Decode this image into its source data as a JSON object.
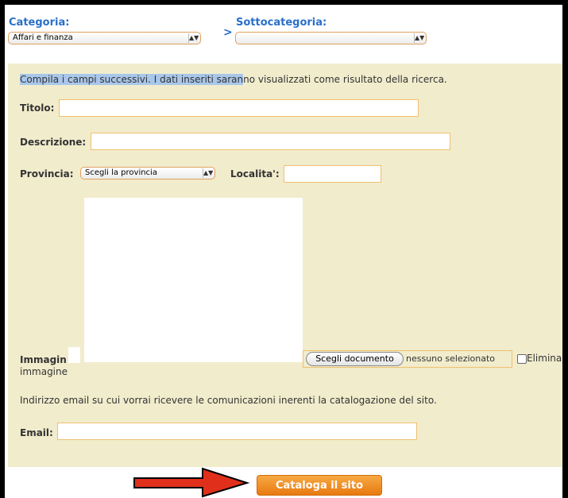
{
  "header": {
    "categoria_label": "Categoria:",
    "categoria_value": "Affari e finanza",
    "separator": ">",
    "sottocategoria_label": "Sottocategoria:",
    "sottocategoria_value": ""
  },
  "form": {
    "intro_highlight": "Compila i campi successivi. I dati inseriti saran",
    "intro_rest": "no visualizzati come risultato della ricerca.",
    "titolo_label": "Titolo:",
    "titolo_value": "",
    "descrizione_label": "Descrizione:",
    "descrizione_value": "",
    "provincia_label": "Provincia:",
    "provincia_value": "Scegli la provincia",
    "localita_label": "Localita':",
    "localita_value": "",
    "immagine_label_1": "Immagin",
    "immagine_label_2": "immagine",
    "file_button": "Scegli documento",
    "file_status": "nessuno selezionato",
    "elimina_label": "Elimina",
    "email_note": "Indirizzo email su cui vorrai ricevere le comunicazioni inerenti la catalogazione del sito.",
    "email_label": "Email:",
    "email_value": ""
  },
  "submit": {
    "label": "Cataloga il sito"
  },
  "colors": {
    "panel": "#f1eccc",
    "accent_blue": "#2a6fc9",
    "submit_orange": "#e87a10",
    "arrow_red": "#e0301c"
  },
  "icons": {
    "select_arrows": "up-down-arrows",
    "pointer": "red-arrow-right"
  }
}
